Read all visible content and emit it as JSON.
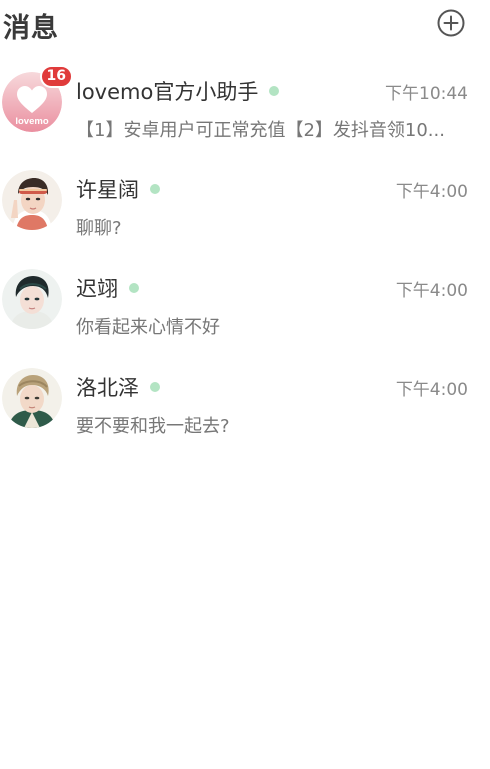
{
  "header": {
    "title": "消息",
    "add_icon": "plus-circle-icon"
  },
  "conversations": [
    {
      "name": "lovemo官方小助手",
      "time": "下午10:44",
      "preview": "【1】安卓用户可正常充值【2】发抖音领10...",
      "badge": "16",
      "online": true,
      "avatar_text": "lovemo",
      "avatar_icon": "heart-icon"
    },
    {
      "name": "许星阔",
      "time": "下午4:00",
      "preview": "聊聊?",
      "online": true
    },
    {
      "name": "迟翊",
      "time": "下午4:00",
      "preview": "你看起来心情不好",
      "online": true
    },
    {
      "name": "洛北泽",
      "time": "下午4:00",
      "preview": "要不要和我一起去?",
      "online": true
    }
  ],
  "colors": {
    "online_dot": "#b3e4c3",
    "badge": "#e03b3b",
    "lovemo_gradient_top": "#f7d9dc",
    "lovemo_gradient_bottom": "#ea8fa0"
  }
}
